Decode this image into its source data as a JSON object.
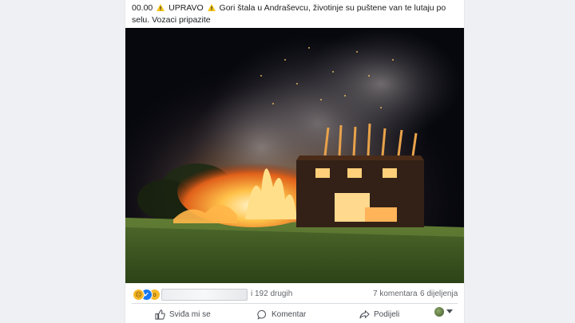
{
  "post": {
    "time": "00.00",
    "label": "UPRAVO",
    "text": "Gori štala u Andraševcu, životinje su puštene van te lutaju po selu. Vozaci pripazite"
  },
  "reactions": {
    "others_text": "i 192 drugih",
    "comments": "7 komentara",
    "shares": "6 dijeljenja",
    "icons": [
      "sad-icon",
      "like-icon",
      "wow-icon"
    ]
  },
  "actions": {
    "like": "Sviđa mi se",
    "comment": "Komentar",
    "share": "Podijeli"
  },
  "colors": {
    "like_blue": "#1877f2",
    "reaction_yellow": "#f7b928",
    "warning_yellow": "#f5c518"
  }
}
